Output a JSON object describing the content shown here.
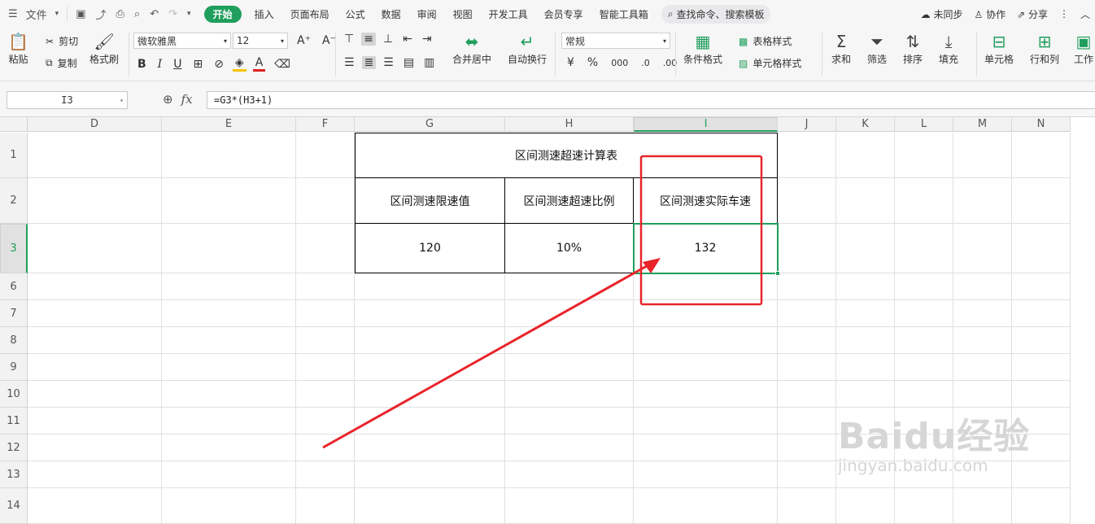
{
  "menubar": {
    "file_label": "文件",
    "tabs": [
      "开始",
      "插入",
      "页面布局",
      "公式",
      "数据",
      "审阅",
      "视图",
      "开发工具",
      "会员专享",
      "智能工具箱"
    ],
    "active_tab": "开始",
    "search_placeholder": "查找命令、搜索模板",
    "sync_label": "未同步",
    "collab_label": "协作",
    "share_label": "分享"
  },
  "ribbon": {
    "paste": "粘贴",
    "cut": "剪切",
    "copy": "复制",
    "format_painter": "格式刷",
    "font_name": "微软雅黑",
    "font_size": "12",
    "merge_center": "合并居中",
    "wrap_text": "自动换行",
    "number_format": "常规",
    "conditional_format": "条件格式",
    "table_style": "表格样式",
    "cell_style": "单元格样式",
    "sum": "求和",
    "filter": "筛选",
    "sort": "排序",
    "fill": "填充",
    "cell": "单元格",
    "row_col": "行和列",
    "worksheet": "工作"
  },
  "formula_bar": {
    "cell_ref": "I3",
    "fx": "fx",
    "formula": "=G3*(H3+1)"
  },
  "sheet": {
    "columns": [
      "D",
      "E",
      "F",
      "G",
      "H",
      "I",
      "J",
      "K",
      "L",
      "M",
      "N"
    ],
    "rows": [
      "1",
      "2",
      "3",
      "6",
      "7",
      "8",
      "9",
      "10",
      "11",
      "12",
      "13",
      "14"
    ],
    "selected_column": "I",
    "selected_row": "3",
    "table": {
      "title": "区间测速超速计算表",
      "headers": [
        "区间测速限速值",
        "区间测速超速比例",
        "区间测速实际车速"
      ],
      "values": [
        "120",
        "10%",
        "132"
      ]
    }
  },
  "annotation": {
    "highlight_color": "#e8242a",
    "selection_color": "#1f9e5c"
  },
  "watermark": {
    "brand": "Baidu经验",
    "url": "jingyan.baidu.com"
  }
}
